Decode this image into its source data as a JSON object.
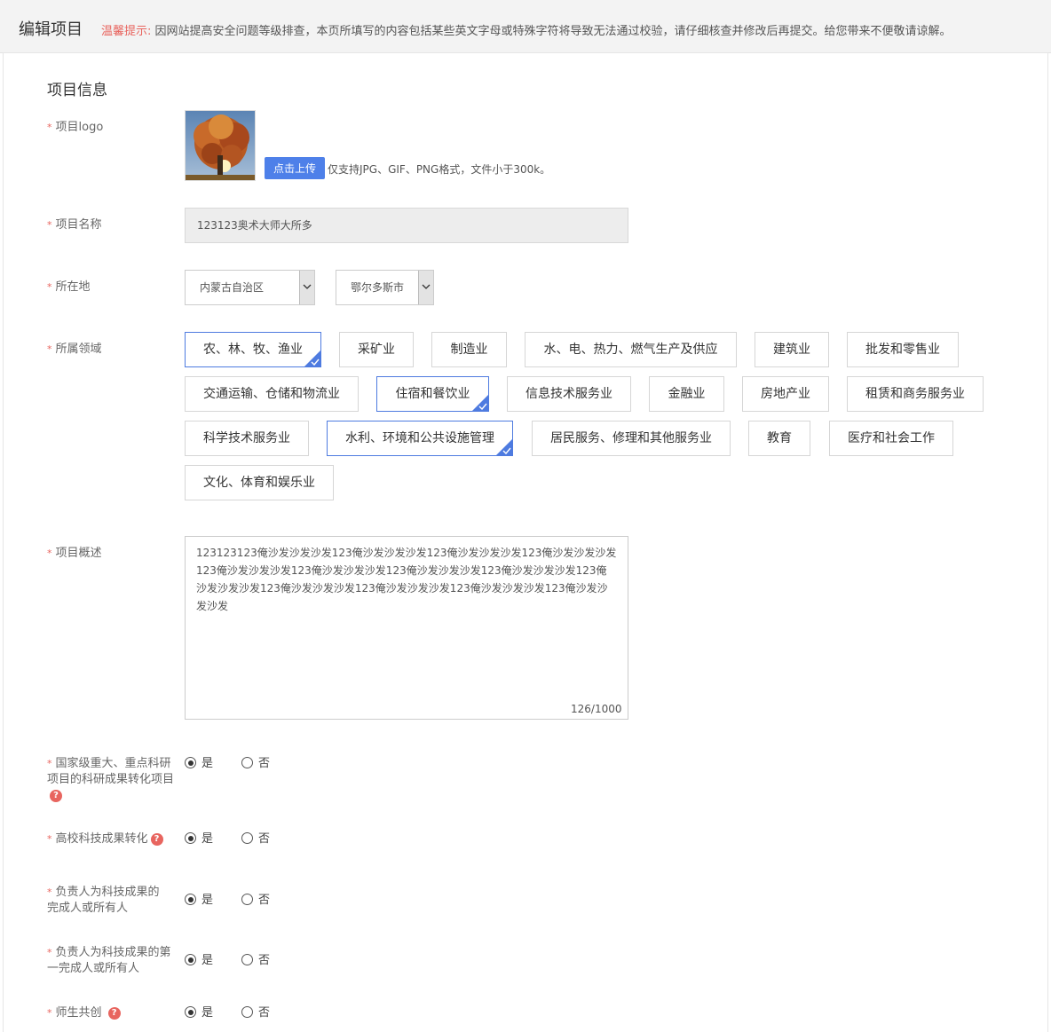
{
  "header": {
    "title": "编辑项目",
    "tip_label": "温馨提示:",
    "tip_text": "因网站提高安全问题等级排查，本页所填写的内容包括某些英文字母或特殊字符将导致无法通过校验，请仔细核查并修改后再提交。给您带来不便敬请谅解。"
  },
  "form": {
    "section_title": "项目信息",
    "required_mark": "*",
    "help_mark": "?",
    "logo": {
      "label": "项目logo",
      "upload_button": "点击上传",
      "hint": "仅支持JPG、GIF、PNG格式，文件小于300k。"
    },
    "name": {
      "label": "项目名称",
      "value": "123123奥术大师大所多"
    },
    "location": {
      "label": "所在地",
      "province": "内蒙古自治区",
      "city": "鄂尔多斯市"
    },
    "domain": {
      "label": "所属领域",
      "tags": [
        {
          "label": "农、林、牧、渔业",
          "selected": true
        },
        {
          "label": "采矿业",
          "selected": false
        },
        {
          "label": "制造业",
          "selected": false
        },
        {
          "label": "水、电、热力、燃气生产及供应",
          "selected": false
        },
        {
          "label": "建筑业",
          "selected": false
        },
        {
          "label": "批发和零售业",
          "selected": false
        },
        {
          "label": "交通运输、仓储和物流业",
          "selected": false
        },
        {
          "label": "住宿和餐饮业",
          "selected": true
        },
        {
          "label": "信息技术服务业",
          "selected": false
        },
        {
          "label": "金融业",
          "selected": false
        },
        {
          "label": "房地产业",
          "selected": false
        },
        {
          "label": "租赁和商务服务业",
          "selected": false
        },
        {
          "label": "科学技术服务业",
          "selected": false
        },
        {
          "label": "水利、环境和公共设施管理",
          "selected": true
        },
        {
          "label": "居民服务、修理和其他服务业",
          "selected": false
        },
        {
          "label": "教育",
          "selected": false
        },
        {
          "label": "医疗和社会工作",
          "selected": false
        },
        {
          "label": "文化、体育和娱乐业",
          "selected": false
        }
      ]
    },
    "overview": {
      "label": "项目概述",
      "value": "123123123俺沙发沙发沙发123俺沙发沙发沙发123俺沙发沙发沙发123俺沙发沙发沙发123俺沙发沙发沙发123俺沙发沙发沙发123俺沙发沙发沙发123俺沙发沙发沙发123俺沙发沙发沙发123俺沙发沙发沙发123俺沙发沙发沙发123俺沙发沙发沙发123俺沙发沙发沙发",
      "counter": "126/1000"
    },
    "yes_label": "是",
    "no_label": "否",
    "questions": [
      {
        "label": "国家级重大、重点科研项目的科研成果转化项目",
        "selected": "yes",
        "help": true
      },
      {
        "label": "高校科技成果转化",
        "selected": "yes",
        "help": true
      },
      {
        "label": "负责人为科技成果的完成人或所有人",
        "selected": "yes",
        "help": false
      },
      {
        "label": "负责人为科技成果的第一完成人或所有人",
        "selected": "yes",
        "help": false
      },
      {
        "label": "师生共创",
        "selected": "yes",
        "help": true
      }
    ]
  },
  "colors": {
    "accent": "#4e80e9",
    "required": "#e8655f",
    "selected_border": "#4e7be0"
  }
}
